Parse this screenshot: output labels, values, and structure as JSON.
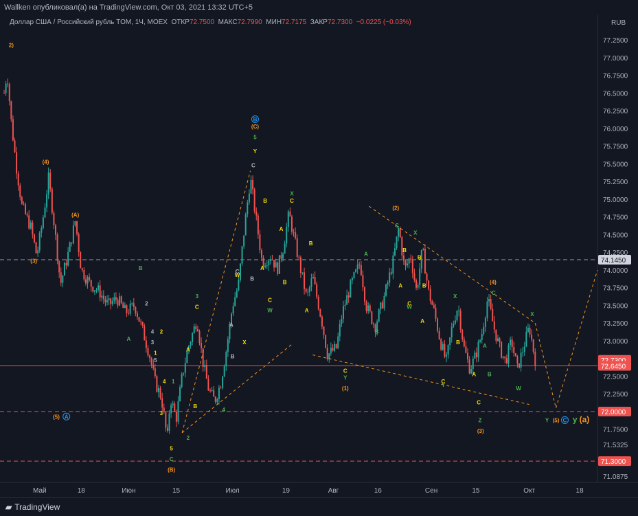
{
  "header": {
    "publish_line": "Wallken опубликовал(а) на TradingView.com, Окт 03, 2021 13:32 UTC+5"
  },
  "legend": {
    "symbol": "Доллар США / Российский рубль TOM, 1Ч, MOEX",
    "open_label": "ОТКР",
    "open_value": "72.7500",
    "high_label": "МАКС",
    "high_value": "72.7990",
    "low_label": "МИН",
    "low_value": "72.7175",
    "close_label": "ЗАКР",
    "close_value": "72.7300",
    "change": "−0.0225 (−0.03%)"
  },
  "footer": {
    "brand": "TradingView"
  },
  "colors": {
    "up": "#26a69a",
    "down": "#ef5350",
    "orange": "#f7931a",
    "yellow": "#f5d90a",
    "green": "#4caf50",
    "gray": "#b2b5be",
    "blue": "#2196f3",
    "background": "#131722"
  },
  "chart_data": {
    "type": "candlestick",
    "currency": "RUB",
    "ylim": [
      71.0,
      77.6
    ],
    "y_ticks": [
      "77.2500",
      "77.0000",
      "76.7500",
      "76.5000",
      "76.2500",
      "76.0000",
      "75.7500",
      "75.5000",
      "75.2500",
      "75.0000",
      "74.7500",
      "74.5000",
      "74.2500",
      "74.0000",
      "73.7500",
      "73.5000",
      "73.2500",
      "73.0000",
      "72.7500",
      "72.5000",
      "72.2500",
      "72.0000",
      "71.7500",
      "71.5325",
      "71.3000",
      "71.0875"
    ],
    "y_tick_values": [
      77.25,
      77.0,
      76.75,
      76.5,
      76.25,
      76.0,
      75.75,
      75.5,
      75.25,
      75.0,
      74.75,
      74.5,
      74.25,
      74.0,
      73.75,
      73.5,
      73.25,
      73.0,
      72.75,
      72.5,
      72.25,
      72.0,
      71.75,
      71.5325,
      71.3,
      71.0875
    ],
    "x_ticks": [
      "Май",
      "18",
      "Июн",
      "15",
      "Июл",
      "19",
      "Авг",
      "16",
      "Сен",
      "15",
      "Окт",
      "18"
    ],
    "x_tick_positions": [
      0.06,
      0.13,
      0.21,
      0.29,
      0.385,
      0.475,
      0.555,
      0.63,
      0.72,
      0.795,
      0.885,
      0.97
    ],
    "price_tags": [
      {
        "label": "74.1450",
        "value": 74.145,
        "style": "gray"
      },
      {
        "label": "72.7300",
        "value": 72.73,
        "style": "red"
      },
      {
        "label": "72.6450",
        "value": 72.645,
        "style": "red"
      },
      {
        "label": "72.0000",
        "value": 72.0,
        "style": "red"
      },
      {
        "label": "71.3000",
        "value": 71.3,
        "style": "red"
      }
    ],
    "horizontal_lines": [
      {
        "value": 74.145,
        "style": "dashed-gray"
      },
      {
        "value": 72.645,
        "style": "solid-red"
      },
      {
        "value": 72.0,
        "style": "dashed-red"
      },
      {
        "value": 71.3,
        "style": "dashed-red"
      }
    ],
    "price_path": [
      [
        0.0,
        76.5
      ],
      [
        0.005,
        76.8
      ],
      [
        0.012,
        76.1
      ],
      [
        0.02,
        75.5
      ],
      [
        0.03,
        74.9
      ],
      [
        0.045,
        74.6
      ],
      [
        0.055,
        74.2
      ],
      [
        0.065,
        74.7
      ],
      [
        0.075,
        75.3
      ],
      [
        0.085,
        74.6
      ],
      [
        0.095,
        73.8
      ],
      [
        0.11,
        74.3
      ],
      [
        0.12,
        74.7
      ],
      [
        0.13,
        74.0
      ],
      [
        0.145,
        73.8
      ],
      [
        0.16,
        73.7
      ],
      [
        0.175,
        73.5
      ],
      [
        0.19,
        73.6
      ],
      [
        0.205,
        73.4
      ],
      [
        0.22,
        73.5
      ],
      [
        0.235,
        73.1
      ],
      [
        0.245,
        72.8
      ],
      [
        0.255,
        72.4
      ],
      [
        0.265,
        72.2
      ],
      [
        0.275,
        71.6
      ],
      [
        0.28,
        72.2
      ],
      [
        0.29,
        71.9
      ],
      [
        0.3,
        72.5
      ],
      [
        0.31,
        72.9
      ],
      [
        0.325,
        73.3
      ],
      [
        0.335,
        72.7
      ],
      [
        0.345,
        72.3
      ],
      [
        0.355,
        72.15
      ],
      [
        0.365,
        72.4
      ],
      [
        0.375,
        72.9
      ],
      [
        0.385,
        73.5
      ],
      [
        0.395,
        73.8
      ],
      [
        0.405,
        74.6
      ],
      [
        0.415,
        75.3
      ],
      [
        0.425,
        74.7
      ],
      [
        0.435,
        74.1
      ],
      [
        0.45,
        74.2
      ],
      [
        0.46,
        74.0
      ],
      [
        0.47,
        74.3
      ],
      [
        0.48,
        74.8
      ],
      [
        0.49,
        74.4
      ],
      [
        0.5,
        74.0
      ],
      [
        0.51,
        73.6
      ],
      [
        0.52,
        73.9
      ],
      [
        0.535,
        73.3
      ],
      [
        0.545,
        72.8
      ],
      [
        0.56,
        72.9
      ],
      [
        0.57,
        73.4
      ],
      [
        0.585,
        73.8
      ],
      [
        0.6,
        74.1
      ],
      [
        0.61,
        73.5
      ],
      [
        0.625,
        73.2
      ],
      [
        0.64,
        73.6
      ],
      [
        0.655,
        74.1
      ],
      [
        0.665,
        74.6
      ],
      [
        0.675,
        74.0
      ],
      [
        0.685,
        74.2
      ],
      [
        0.695,
        73.7
      ],
      [
        0.705,
        74.3
      ],
      [
        0.715,
        73.7
      ],
      [
        0.725,
        73.4
      ],
      [
        0.735,
        73.0
      ],
      [
        0.745,
        72.7
      ],
      [
        0.755,
        73.2
      ],
      [
        0.765,
        73.5
      ],
      [
        0.775,
        72.9
      ],
      [
        0.785,
        72.6
      ],
      [
        0.795,
        72.8
      ],
      [
        0.805,
        73.1
      ],
      [
        0.815,
        73.6
      ],
      [
        0.825,
        73.2
      ],
      [
        0.835,
        72.9
      ],
      [
        0.845,
        72.7
      ],
      [
        0.855,
        73.0
      ],
      [
        0.865,
        72.6
      ],
      [
        0.875,
        72.9
      ],
      [
        0.885,
        73.2
      ],
      [
        0.895,
        72.73
      ]
    ],
    "trend_lines": [
      {
        "from": [
          0.3,
          71.7
        ],
        "to": [
          0.415,
          75.4
        ],
        "color": "orange"
      },
      {
        "from": [
          0.3,
          71.7
        ],
        "to": [
          0.485,
          72.95
        ],
        "color": "orange"
      },
      {
        "from": [
          0.52,
          72.8
        ],
        "to": [
          0.885,
          72.1
        ],
        "color": "orange"
      },
      {
        "from": [
          0.615,
          74.9
        ],
        "to": [
          0.895,
          73.25
        ],
        "color": "orange"
      },
      {
        "from": [
          0.895,
          73.25
        ],
        "to": [
          0.93,
          72.05
        ],
        "color": "orange"
      },
      {
        "from": [
          0.93,
          72.05
        ],
        "to": [
          1.0,
          74.0
        ],
        "color": "orange"
      }
    ],
    "wave_labels": [
      {
        "text": "2)",
        "x": 0.012,
        "y": 77.15,
        "color": "orange"
      },
      {
        "text": "(4)",
        "x": 0.07,
        "y": 75.5,
        "color": "orange"
      },
      {
        "text": "(3)",
        "x": 0.05,
        "y": 74.1,
        "color": "orange"
      },
      {
        "text": "(A)",
        "x": 0.12,
        "y": 74.75,
        "color": "orange"
      },
      {
        "text": "B",
        "x": 0.23,
        "y": 74.0,
        "color": "green"
      },
      {
        "text": "A",
        "x": 0.21,
        "y": 73.0,
        "color": "green"
      },
      {
        "text": "2",
        "x": 0.24,
        "y": 73.5,
        "color": "gray"
      },
      {
        "text": "4",
        "x": 0.25,
        "y": 73.1,
        "color": "gray"
      },
      {
        "text": "2",
        "x": 0.265,
        "y": 73.1,
        "color": "yellow"
      },
      {
        "text": "3",
        "x": 0.25,
        "y": 72.95,
        "color": "gray"
      },
      {
        "text": "1",
        "x": 0.255,
        "y": 72.8,
        "color": "yellow"
      },
      {
        "text": "5",
        "x": 0.255,
        "y": 72.7,
        "color": "gray"
      },
      {
        "text": "4",
        "x": 0.27,
        "y": 72.4,
        "color": "yellow"
      },
      {
        "text": "3",
        "x": 0.265,
        "y": 71.95,
        "color": "yellow"
      },
      {
        "text": "5",
        "x": 0.282,
        "y": 71.45,
        "color": "yellow"
      },
      {
        "text": "C",
        "x": 0.282,
        "y": 71.3,
        "color": "green"
      },
      {
        "text": "(B)",
        "x": 0.282,
        "y": 71.15,
        "color": "orange"
      },
      {
        "text": "(5)",
        "x": 0.088,
        "y": 71.9,
        "color": "orange"
      },
      {
        "text": "A",
        "x": 0.105,
        "y": 71.9,
        "color": "blue"
      },
      {
        "text": "1",
        "x": 0.285,
        "y": 72.4,
        "color": "green"
      },
      {
        "text": "A",
        "x": 0.31,
        "y": 72.85,
        "color": "yellow"
      },
      {
        "text": "2",
        "x": 0.31,
        "y": 71.6,
        "color": "green"
      },
      {
        "text": "B",
        "x": 0.322,
        "y": 72.05,
        "color": "yellow"
      },
      {
        "text": "3",
        "x": 0.325,
        "y": 73.6,
        "color": "green"
      },
      {
        "text": "C",
        "x": 0.325,
        "y": 73.45,
        "color": "yellow"
      },
      {
        "text": "4",
        "x": 0.37,
        "y": 72.0,
        "color": "green"
      },
      {
        "text": "B",
        "x": 0.385,
        "y": 72.75,
        "color": "gray"
      },
      {
        "text": "X",
        "x": 0.405,
        "y": 72.95,
        "color": "yellow"
      },
      {
        "text": "A",
        "x": 0.383,
        "y": 73.2,
        "color": "gray"
      },
      {
        "text": "W",
        "x": 0.393,
        "y": 73.9,
        "color": "yellow"
      },
      {
        "text": "C",
        "x": 0.393,
        "y": 73.95,
        "color": "gray"
      },
      {
        "text": "B",
        "x": 0.418,
        "y": 73.85,
        "color": "gray"
      },
      {
        "text": "C",
        "x": 0.42,
        "y": 75.45,
        "color": "gray"
      },
      {
        "text": "Y",
        "x": 0.423,
        "y": 75.65,
        "color": "yellow"
      },
      {
        "text": "5",
        "x": 0.423,
        "y": 75.85,
        "color": "green"
      },
      {
        "text": "(C)",
        "x": 0.423,
        "y": 76.0,
        "color": "orange"
      },
      {
        "text": "B",
        "x": 0.423,
        "y": 76.1,
        "color": "blue"
      },
      {
        "text": "B",
        "x": 0.44,
        "y": 74.95,
        "color": "yellow"
      },
      {
        "text": "A",
        "x": 0.435,
        "y": 74.0,
        "color": "yellow"
      },
      {
        "text": "B",
        "x": 0.473,
        "y": 73.8,
        "color": "yellow"
      },
      {
        "text": "C",
        "x": 0.448,
        "y": 73.55,
        "color": "yellow"
      },
      {
        "text": "W",
        "x": 0.448,
        "y": 73.4,
        "color": "green"
      },
      {
        "text": "A",
        "x": 0.467,
        "y": 74.55,
        "color": "yellow"
      },
      {
        "text": "X",
        "x": 0.485,
        "y": 75.05,
        "color": "green"
      },
      {
        "text": "C",
        "x": 0.485,
        "y": 74.95,
        "color": "yellow"
      },
      {
        "text": "B",
        "x": 0.517,
        "y": 74.35,
        "color": "yellow"
      },
      {
        "text": "A",
        "x": 0.51,
        "y": 73.4,
        "color": "yellow"
      },
      {
        "text": "C",
        "x": 0.575,
        "y": 72.55,
        "color": "yellow"
      },
      {
        "text": "Y",
        "x": 0.575,
        "y": 72.45,
        "color": "green"
      },
      {
        "text": "(1)",
        "x": 0.575,
        "y": 72.3,
        "color": "orange"
      },
      {
        "text": "A",
        "x": 0.61,
        "y": 74.2,
        "color": "green"
      },
      {
        "text": "B",
        "x": 0.628,
        "y": 73.1,
        "color": "green"
      },
      {
        "text": "(2)",
        "x": 0.66,
        "y": 74.85,
        "color": "orange"
      },
      {
        "text": "C",
        "x": 0.662,
        "y": 74.6,
        "color": "green"
      },
      {
        "text": "X",
        "x": 0.693,
        "y": 74.5,
        "color": "green"
      },
      {
        "text": "B",
        "x": 0.675,
        "y": 74.25,
        "color": "yellow"
      },
      {
        "text": "A",
        "x": 0.668,
        "y": 73.75,
        "color": "yellow"
      },
      {
        "text": "B",
        "x": 0.7,
        "y": 74.15,
        "color": "yellow"
      },
      {
        "text": "B",
        "x": 0.708,
        "y": 73.75,
        "color": "yellow"
      },
      {
        "text": "C",
        "x": 0.683,
        "y": 73.5,
        "color": "yellow"
      },
      {
        "text": "W",
        "x": 0.683,
        "y": 73.45,
        "color": "green"
      },
      {
        "text": "A",
        "x": 0.705,
        "y": 73.25,
        "color": "yellow"
      },
      {
        "text": "X",
        "x": 0.76,
        "y": 73.6,
        "color": "green"
      },
      {
        "text": "B",
        "x": 0.765,
        "y": 72.95,
        "color": "yellow"
      },
      {
        "text": "C",
        "x": 0.74,
        "y": 72.4,
        "color": "yellow"
      },
      {
        "text": "Y",
        "x": 0.74,
        "y": 72.35,
        "color": "green"
      },
      {
        "text": "A",
        "x": 0.792,
        "y": 72.5,
        "color": "yellow"
      },
      {
        "text": "C",
        "x": 0.8,
        "y": 72.1,
        "color": "yellow"
      },
      {
        "text": "Z",
        "x": 0.802,
        "y": 71.85,
        "color": "green"
      },
      {
        "text": "(3)",
        "x": 0.803,
        "y": 71.7,
        "color": "orange"
      },
      {
        "text": "B",
        "x": 0.818,
        "y": 72.5,
        "color": "green"
      },
      {
        "text": "A",
        "x": 0.81,
        "y": 72.9,
        "color": "green"
      },
      {
        "text": "(4)",
        "x": 0.824,
        "y": 73.8,
        "color": "orange"
      },
      {
        "text": "C",
        "x": 0.825,
        "y": 73.65,
        "color": "green"
      },
      {
        "text": "W",
        "x": 0.867,
        "y": 72.3,
        "color": "green"
      },
      {
        "text": "X",
        "x": 0.89,
        "y": 73.35,
        "color": "green"
      },
      {
        "text": "Y",
        "x": 0.915,
        "y": 71.85,
        "color": "green"
      },
      {
        "text": "(5)",
        "x": 0.93,
        "y": 71.85,
        "color": "orange"
      },
      {
        "text": "C",
        "x": 0.945,
        "y": 71.85,
        "color": "blue"
      },
      {
        "text": "y",
        "x": 0.962,
        "y": 71.85,
        "color": "green"
      },
      {
        "text": "(a)",
        "x": 0.978,
        "y": 71.85,
        "color": "orange"
      }
    ]
  }
}
